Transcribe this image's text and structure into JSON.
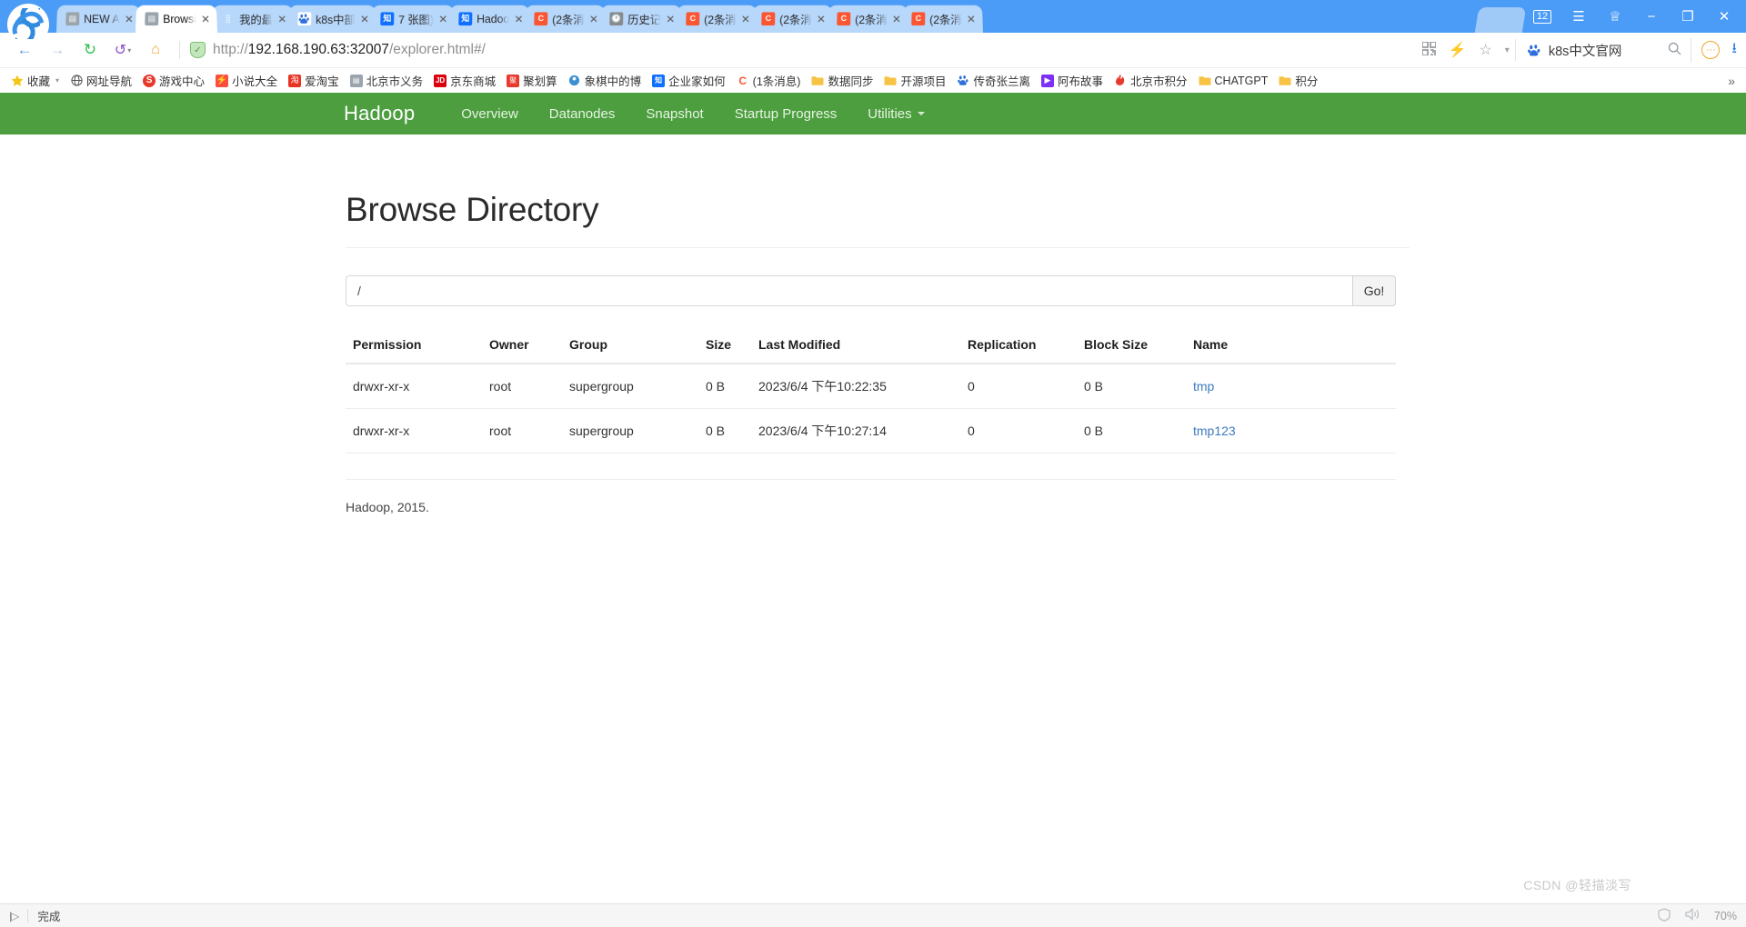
{
  "browser": {
    "tabs": [
      {
        "title": "NEW A",
        "icon": "document-icon",
        "icon_kind": "doc",
        "active": false
      },
      {
        "title": "Browsi",
        "icon": "document-icon",
        "icon_kind": "doc",
        "active": true
      },
      {
        "title": "我的最",
        "icon": "grid-icon",
        "icon_kind": "grid",
        "active": false
      },
      {
        "title": "k8s中部",
        "icon": "baidu-icon",
        "icon_kind": "baidu",
        "active": false
      },
      {
        "title": "7 张图)",
        "icon": "zhihu-icon",
        "icon_kind": "zhihu",
        "active": false
      },
      {
        "title": "Hadoo",
        "icon": "zhihu-icon",
        "icon_kind": "zhihu",
        "active": false
      },
      {
        "title": "(2条消",
        "icon": "csdn-icon",
        "icon_kind": "csdn",
        "active": false
      },
      {
        "title": "历史记",
        "icon": "clock-icon",
        "icon_kind": "clock",
        "active": false
      },
      {
        "title": "(2条消",
        "icon": "csdn-icon",
        "icon_kind": "csdn",
        "active": false
      },
      {
        "title": "(2条消",
        "icon": "csdn-icon",
        "icon_kind": "csdn",
        "active": false
      },
      {
        "title": "(2条消",
        "icon": "csdn-icon",
        "icon_kind": "csdn",
        "active": false
      },
      {
        "title": "(2条消",
        "icon": "csdn-icon",
        "icon_kind": "csdn",
        "active": false
      }
    ],
    "tab_close_glyph": "✕",
    "window_controls": {
      "tab_count": "12",
      "menu_glyph": "☰",
      "skin_glyph": "♕",
      "minimize_glyph": "−",
      "maximize_glyph": "❐",
      "close_glyph": "✕"
    },
    "toolbar": {
      "back_glyph": "←",
      "forward_glyph": "→",
      "reload_glyph": "↻",
      "history_glyph": "↺",
      "home_glyph": "⌂",
      "security_glyph": "✓",
      "url_scheme": "http://",
      "url_host": "192.168.190.63:32007",
      "url_path": "/explorer.html#/",
      "qr_glyph": "▣",
      "bolt_glyph": "⚡",
      "star_glyph": "☆",
      "caret_glyph": "▾",
      "search_engine": "baidu-icon",
      "search_text": "k8s中文官网",
      "search_glyph": "🔍",
      "more_glyph": "···",
      "download_glyph": "⭳"
    },
    "bookmarks": [
      {
        "label": "收藏",
        "icon_kind": "star",
        "caret": true
      },
      {
        "label": "网址导航",
        "icon_kind": "globe",
        "caret": false
      },
      {
        "label": "游戏中心",
        "icon_kind": "s",
        "caret": false
      },
      {
        "label": "小说大全",
        "icon_kind": "novel",
        "caret": false
      },
      {
        "label": "爱淘宝",
        "icon_kind": "tao",
        "caret": false
      },
      {
        "label": "北京市义务",
        "icon_kind": "doc",
        "caret": false
      },
      {
        "label": "京东商城",
        "icon_kind": "jd",
        "caret": false
      },
      {
        "label": "聚划算",
        "icon_kind": "ju",
        "caret": false
      },
      {
        "label": "象棋中的博",
        "icon_kind": "chess",
        "caret": false
      },
      {
        "label": "企业家如何",
        "icon_kind": "zhihu",
        "caret": false
      },
      {
        "label": "(1条消息)",
        "icon_kind": "csdn",
        "caret": false
      },
      {
        "label": "数据同步",
        "icon_kind": "folder",
        "caret": false
      },
      {
        "label": "开源项目",
        "icon_kind": "folder",
        "caret": false
      },
      {
        "label": "传奇张兰离",
        "icon_kind": "baidu2",
        "caret": false
      },
      {
        "label": "阿布故事",
        "icon_kind": "abu",
        "caret": false
      },
      {
        "label": "北京市积分",
        "icon_kind": "fire",
        "caret": false
      },
      {
        "label": "CHATGPT",
        "icon_kind": "folder",
        "caret": false
      },
      {
        "label": "积分",
        "icon_kind": "folder",
        "caret": false
      }
    ],
    "bookmarks_overflow_glyph": "»",
    "statusbar": {
      "play_glyph": "|▷",
      "status_text": "完成",
      "shield_glyph": "🛡",
      "sound_glyph": "🔊",
      "zoom_label": "70%"
    }
  },
  "hadoop": {
    "brand": "Hadoop",
    "nav": [
      {
        "label": "Overview",
        "dropdown": false
      },
      {
        "label": "Datanodes",
        "dropdown": false
      },
      {
        "label": "Snapshot",
        "dropdown": false
      },
      {
        "label": "Startup Progress",
        "dropdown": false
      },
      {
        "label": "Utilities",
        "dropdown": true
      }
    ],
    "page_title": "Browse Directory",
    "path_value": "/",
    "path_placeholder": "",
    "go_label": "Go!",
    "table": {
      "columns": [
        "Permission",
        "Owner",
        "Group",
        "Size",
        "Last Modified",
        "Replication",
        "Block Size",
        "Name"
      ],
      "rows": [
        {
          "permission": "drwxr-xr-x",
          "owner": "root",
          "group": "supergroup",
          "size": "0 B",
          "last_modified": "2023/6/4 下午10:22:35",
          "replication": "0",
          "block_size": "0 B",
          "name": "tmp"
        },
        {
          "permission": "drwxr-xr-x",
          "owner": "root",
          "group": "supergroup",
          "size": "0 B",
          "last_modified": "2023/6/4 下午10:27:14",
          "replication": "0",
          "block_size": "0 B",
          "name": "tmp123"
        }
      ]
    },
    "footer": "Hadoop, 2015."
  },
  "watermark": "CSDN @轻描淡写",
  "colors": {
    "hadoop_green": "#4c9e3f",
    "chrome_blue": "#4a9cf6",
    "link_blue": "#3c7bbf"
  }
}
